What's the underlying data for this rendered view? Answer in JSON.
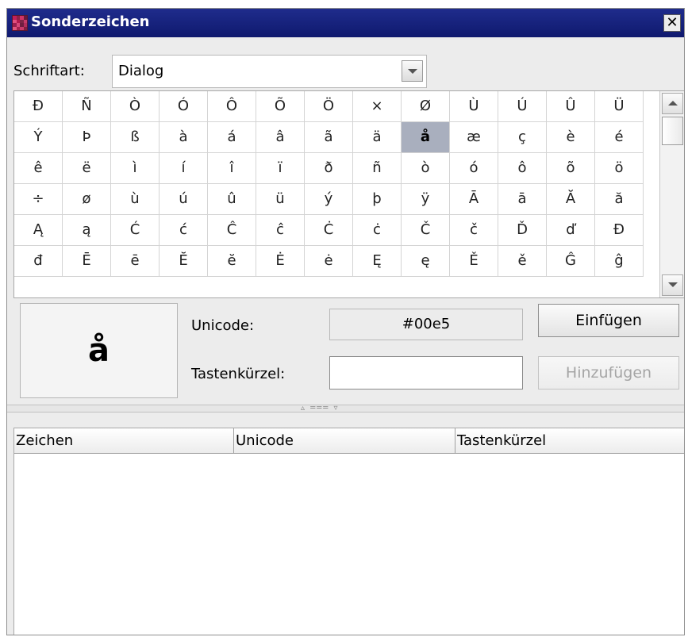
{
  "window": {
    "title": "Sonderzeichen",
    "close_glyph": "✕"
  },
  "font_selector": {
    "label": "Schriftart:",
    "value": "Dialog"
  },
  "char_grid": {
    "selected_index": 21,
    "cells": [
      "Ð",
      "Ñ",
      "Ò",
      "Ó",
      "Ô",
      "Õ",
      "Ö",
      "×",
      "Ø",
      "Ù",
      "Ú",
      "Û",
      "Ü",
      "Ý",
      "Þ",
      "ß",
      "à",
      "á",
      "â",
      "ã",
      "ä",
      "å",
      "æ",
      "ç",
      "è",
      "é",
      "ê",
      "ë",
      "ì",
      "í",
      "î",
      "ï",
      "ð",
      "ñ",
      "ò",
      "ó",
      "ô",
      "õ",
      "ö",
      "÷",
      "ø",
      "ù",
      "ú",
      "û",
      "ü",
      "ý",
      "þ",
      "ÿ",
      "Ā",
      "ā",
      "Ă",
      "ă",
      "Ą",
      "ą",
      "Ć",
      "ć",
      "Ĉ",
      "ĉ",
      "Ċ",
      "ċ",
      "Č",
      "č",
      "Ď",
      "ď",
      "Đ",
      "đ",
      "Ē",
      "ē",
      "Ĕ",
      "ĕ",
      "Ė",
      "ė",
      "Ę",
      "ę",
      "Ě",
      "ě",
      "Ĝ",
      "ĝ"
    ]
  },
  "preview": {
    "char": "å"
  },
  "details": {
    "unicode_label": "Unicode:",
    "unicode_value": "#00e5",
    "shortcut_label": "Tastenkürzel:",
    "shortcut_value": ""
  },
  "buttons": {
    "insert": "Einfügen",
    "add": "Hinzufügen"
  },
  "table": {
    "columns": [
      "Zeichen",
      "Unicode",
      "Tastenkürzel"
    ],
    "rows": []
  },
  "icon_colors": [
    "#c01f5a",
    "#8c2246",
    "#d03466",
    "#6a1a3a",
    "#e24f7f",
    "#b2194e",
    "#7d2547",
    "#c53b6a",
    "#9c1f4f",
    "#d8487a",
    "#6f1e40",
    "#b42d5d",
    "#e2557f",
    "#a4224f",
    "#c93a6d",
    "#81203f"
  ]
}
